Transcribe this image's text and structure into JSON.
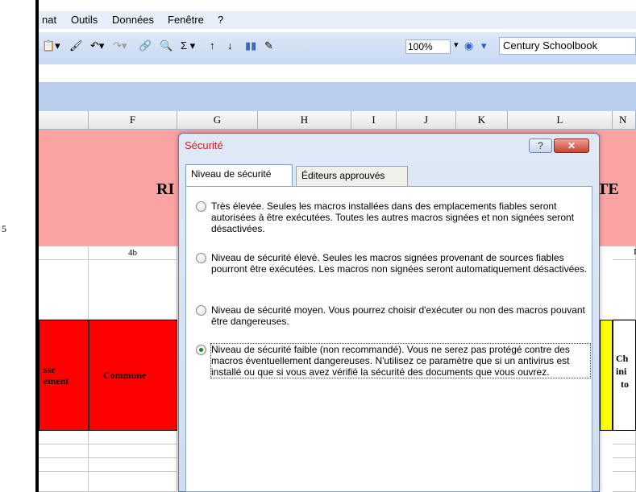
{
  "left_page": {
    "page_number": "5"
  },
  "menu": {
    "items": [
      "nat",
      "Outils",
      "Données",
      "Fenêtre",
      "?"
    ]
  },
  "toolbar": {
    "zoom": "100%",
    "font_name": "Century Schoolbook"
  },
  "columns": [
    "F",
    "G",
    "H",
    "I",
    "J",
    "K",
    "L",
    "N"
  ],
  "sheet": {
    "title_left": "RI",
    "title_right": "TE",
    "row_4b": "4b",
    "row_I": "I",
    "commune": "Commune",
    "left_fragment_line1": "sse",
    "left_fragment_line2": "ement",
    "right_fragment_line1": "Ch",
    "right_fragment_line2": "ini",
    "right_fragment_line3": "to"
  },
  "dialog": {
    "title": "Sécurité",
    "help_label": "?",
    "close_label": "✕",
    "tabs": [
      "Niveau de sécurité",
      "Éditeurs approuvés"
    ],
    "options": [
      {
        "text": "Très élevée. Seules les macros installées dans des emplacements fiables seront autorisées à être exécutées. Toutes les autres macros signées et non signées seront désactivées.",
        "selected": false
      },
      {
        "text": "Niveau de sécurité élevé. Seules les macros signées provenant de sources fiables pourront être exécutées. Les macros non signées seront automatiquement désactivées.",
        "selected": false
      },
      {
        "text": "Niveau de sécurité moyen. Vous pourrez choisir d'exécuter ou non des macros pouvant être dangereuses.",
        "selected": false
      },
      {
        "text": "Niveau de sécurité faible (non recommandé). Vous ne serez pas protégé contre des macros éventuellement dangereuses. N'utilisez ce paramètre que si un antivirus est installé ou que si vous avez vérifié la sécurité des documents que vous ouvrez.",
        "selected": true
      }
    ]
  },
  "colors": {
    "title_pink": "#f9a3a3",
    "header_red": "#ff0000",
    "yellow": "#ffff00",
    "dialog_title_red": "#d02020"
  }
}
